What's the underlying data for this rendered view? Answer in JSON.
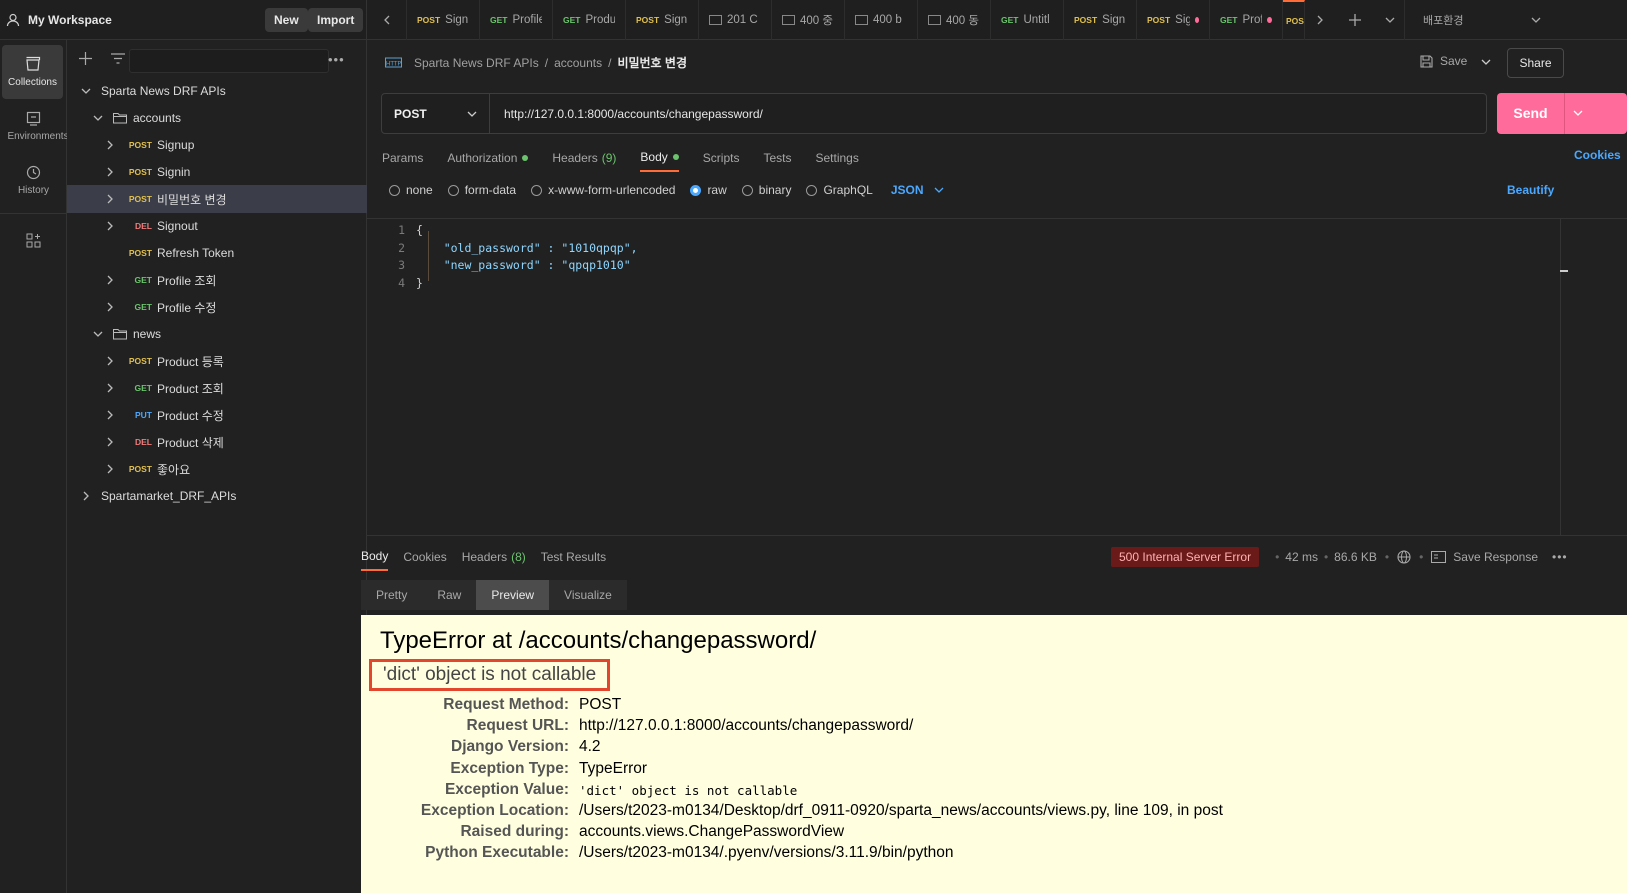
{
  "workspace": {
    "name": "My Workspace",
    "new_label": "New",
    "import_label": "Import"
  },
  "tabs": [
    {
      "method": "POST",
      "label": "Sign",
      "kind": "post"
    },
    {
      "method": "GET",
      "label": "Profile",
      "kind": "get"
    },
    {
      "method": "GET",
      "label": "Produ",
      "kind": "get"
    },
    {
      "method": "POST",
      "label": "Sign",
      "kind": "post"
    },
    {
      "method": "",
      "label": "201 C",
      "kind": "example"
    },
    {
      "method": "",
      "label": "400 중",
      "kind": "example"
    },
    {
      "method": "",
      "label": "400 b",
      "kind": "example"
    },
    {
      "method": "",
      "label": "400 동",
      "kind": "example"
    },
    {
      "method": "GET",
      "label": "Untitl",
      "kind": "get"
    },
    {
      "method": "POST",
      "label": "Sign",
      "kind": "post"
    },
    {
      "method": "POST",
      "label": "Sigr",
      "kind": "post",
      "dot": true
    },
    {
      "method": "GET",
      "label": "Profi",
      "kind": "get",
      "dot": true
    },
    {
      "method": "POS",
      "label": "",
      "kind": "post",
      "active": true
    }
  ],
  "environment": "배포환경",
  "rail": [
    {
      "label": "Collections",
      "icon": "collections-icon"
    },
    {
      "label": "Environments",
      "icon": "environments-icon"
    },
    {
      "label": "History",
      "icon": "history-icon"
    },
    {
      "label": "",
      "icon": "add-apps-icon"
    }
  ],
  "tree": [
    {
      "depth": 0,
      "type": "collection",
      "label": "Sparta News DRF APIs",
      "expanded": true
    },
    {
      "depth": 1,
      "type": "folder",
      "label": "accounts",
      "expanded": true
    },
    {
      "depth": 2,
      "type": "request",
      "method": "POST",
      "label": "Signup"
    },
    {
      "depth": 2,
      "type": "request",
      "method": "POST",
      "label": "Signin"
    },
    {
      "depth": 2,
      "type": "request",
      "method": "POST",
      "label": "비밀번호 변경",
      "selected": true
    },
    {
      "depth": 2,
      "type": "request",
      "method": "DEL",
      "label": "Signout"
    },
    {
      "depth": 2,
      "type": "request",
      "method": "POST",
      "label": "Refresh Token",
      "nochevron": true
    },
    {
      "depth": 2,
      "type": "request",
      "method": "GET",
      "label": "Profile 조회"
    },
    {
      "depth": 2,
      "type": "request",
      "method": "GET",
      "label": "Profile 수정"
    },
    {
      "depth": 1,
      "type": "folder",
      "label": "news",
      "expanded": true
    },
    {
      "depth": 2,
      "type": "request",
      "method": "POST",
      "label": "Product 등록"
    },
    {
      "depth": 2,
      "type": "request",
      "method": "GET",
      "label": "Product 조회"
    },
    {
      "depth": 2,
      "type": "request",
      "method": "PUT",
      "label": "Product 수정"
    },
    {
      "depth": 2,
      "type": "request",
      "method": "DEL",
      "label": "Product 삭제"
    },
    {
      "depth": 2,
      "type": "request",
      "method": "POST",
      "label": "좋아요"
    },
    {
      "depth": 0,
      "type": "collection",
      "label": "Spartamarket_DRF_APIs",
      "expanded": false
    }
  ],
  "breadcrumb": {
    "collection": "Sparta News DRF APIs",
    "folder": "accounts",
    "request": "비밀번호 변경",
    "sep": "/"
  },
  "actions": {
    "save": "Save",
    "share": "Share"
  },
  "request": {
    "method": "POST",
    "url": "http://127.0.0.1:8000/accounts/changepassword/",
    "send": "Send"
  },
  "request_tabs": [
    {
      "label": "Params"
    },
    {
      "label": "Authorization",
      "dot": true
    },
    {
      "label": "Headers",
      "count": "(9)"
    },
    {
      "label": "Body",
      "dot": true,
      "active": true
    },
    {
      "label": "Scripts"
    },
    {
      "label": "Tests"
    },
    {
      "label": "Settings"
    }
  ],
  "cookies_link": "Cookies",
  "body_options": [
    {
      "label": "none"
    },
    {
      "label": "form-data"
    },
    {
      "label": "x-www-form-urlencoded"
    },
    {
      "label": "raw",
      "checked": true
    },
    {
      "label": "binary"
    },
    {
      "label": "GraphQL"
    }
  ],
  "body_format": "JSON",
  "beautify": "Beautify",
  "editor_lines": [
    {
      "n": "1",
      "text": "{"
    },
    {
      "n": "2",
      "text": "    \"old_password\" : \"1010qpqp\","
    },
    {
      "n": "3",
      "text": "    \"new_password\" : \"qpqp1010\""
    },
    {
      "n": "4",
      "text": "}"
    }
  ],
  "response_tabs": [
    {
      "label": "Body",
      "active": true
    },
    {
      "label": "Cookies"
    },
    {
      "label": "Headers",
      "count": "(8)"
    },
    {
      "label": "Test Results"
    }
  ],
  "response_meta": {
    "status": "500 Internal Server Error",
    "time": "42 ms",
    "size": "86.6 KB",
    "save_response": "Save Response"
  },
  "view_tabs": [
    {
      "label": "Pretty"
    },
    {
      "label": "Raw"
    },
    {
      "label": "Preview",
      "active": true
    },
    {
      "label": "Visualize"
    }
  ],
  "preview": {
    "title": "TypeError at /accounts/changepassword/",
    "exception_summary": "'dict' object is not callable",
    "rows": [
      {
        "key": "Request Method:",
        "value": "POST"
      },
      {
        "key": "Request URL:",
        "value": "http://127.0.0.1:8000/accounts/changepassword/"
      },
      {
        "key": "Django Version:",
        "value": "4.2"
      },
      {
        "key": "Exception Type:",
        "value": "TypeError"
      },
      {
        "key": "Exception Value:",
        "value": "'dict' object is not callable",
        "mono": true
      },
      {
        "key": "Exception Location:",
        "value": "/Users/t2023-m0134/Desktop/drf_0911-0920/sparta_news/accounts/views.py, line 109, in post"
      },
      {
        "key": "Raised during:",
        "value": "accounts.views.ChangePasswordView"
      },
      {
        "key": "Python Executable:",
        "value": "/Users/t2023-m0134/.pyenv/versions/3.11.9/bin/python"
      }
    ]
  },
  "colors": {
    "accent": "#ff6c37",
    "send": "#ff6c9c",
    "error_bg": "#6b1a1a",
    "preview_bg": "#ffffe0",
    "highlight": "#e2462c"
  }
}
